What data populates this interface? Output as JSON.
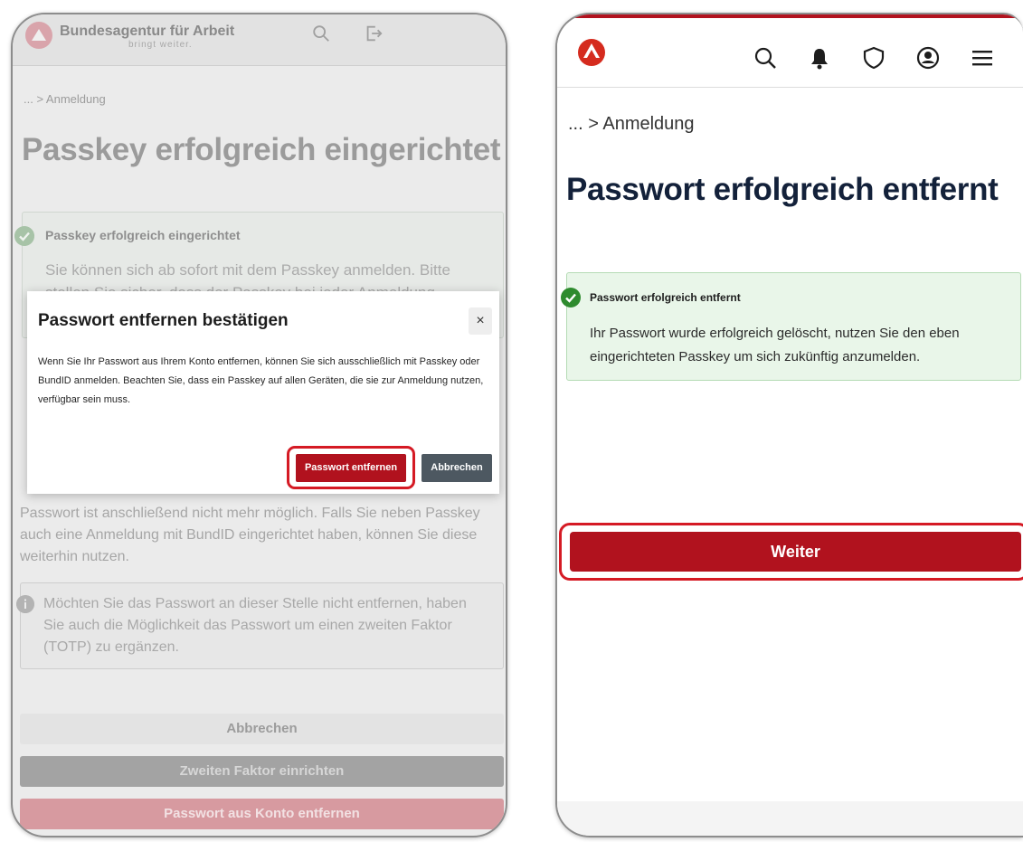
{
  "left_screen": {
    "header": {
      "brand": "Bundesagentur für Arbeit",
      "brand_sub": "bringt weiter."
    },
    "breadcrumb": "... > Anmeldung",
    "page_title": "Passkey erfolgreich eingerichtet",
    "success_box": {
      "title": "Passkey erfolgreich eingerichtet",
      "text": "Sie können sich ab sofort mit dem Passkey anmelden. Bitte stellen Sie sicher, dass der Passkey bei jeder Anmeldung"
    },
    "body_text": "Passwort ist anschließend nicht mehr möglich. Falls Sie neben Passkey auch eine Anmeldung mit BundID eingerichtet haben, können Sie diese weiterhin nutzen.",
    "info_box": {
      "text": "Möchten Sie das Passwort an dieser Stelle nicht entfernen, haben Sie auch die Möglichkeit das Passwort um einen zweiten Faktor (TOTP) zu ergänzen."
    },
    "buttons": {
      "cancel": "Abbrechen",
      "setup_2fa": "Zweiten Faktor einrichten",
      "remove_password": "Passwort aus Konto entfernen"
    },
    "modal": {
      "title": "Passwort entfernen bestätigen",
      "close": "×",
      "text": "Wenn Sie Ihr Passwort aus Ihrem Konto entfernen, können Sie sich ausschließlich mit Passkey oder BundID anmelden. Beachten Sie, dass ein Passkey auf allen Geräten, die sie zur Anmeldung nutzen, verfügbar sein muss.",
      "confirm_label": "Passwort entfernen",
      "cancel_label": "Abbrechen"
    }
  },
  "right_screen": {
    "breadcrumb": "... > Anmeldung",
    "page_title": "Passwort erfolgreich entfernt",
    "success_box": {
      "title": "Passwort erfolgreich entfernt",
      "text": "Ihr Passwort wurde erfolgreich gelöscht, nutzen Sie den eben eingerichteten Passkey um sich zukünftig anzumelden."
    },
    "continue_label": "Weiter"
  },
  "colors": {
    "brand_red": "#b1121e",
    "highlight_red": "#d51a24",
    "title_navy": "#13213a",
    "success_bg": "#e9f6e9",
    "success_border": "#b5dbb5",
    "success_check": "#2e8b2e",
    "secondary_button": "#4d5861"
  },
  "icons": [
    "ba-logo-icon",
    "search-icon",
    "logout-icon",
    "bell-icon",
    "shield-icon",
    "account-icon",
    "menu-icon",
    "check-circle-icon",
    "info-icon",
    "close-icon"
  ]
}
